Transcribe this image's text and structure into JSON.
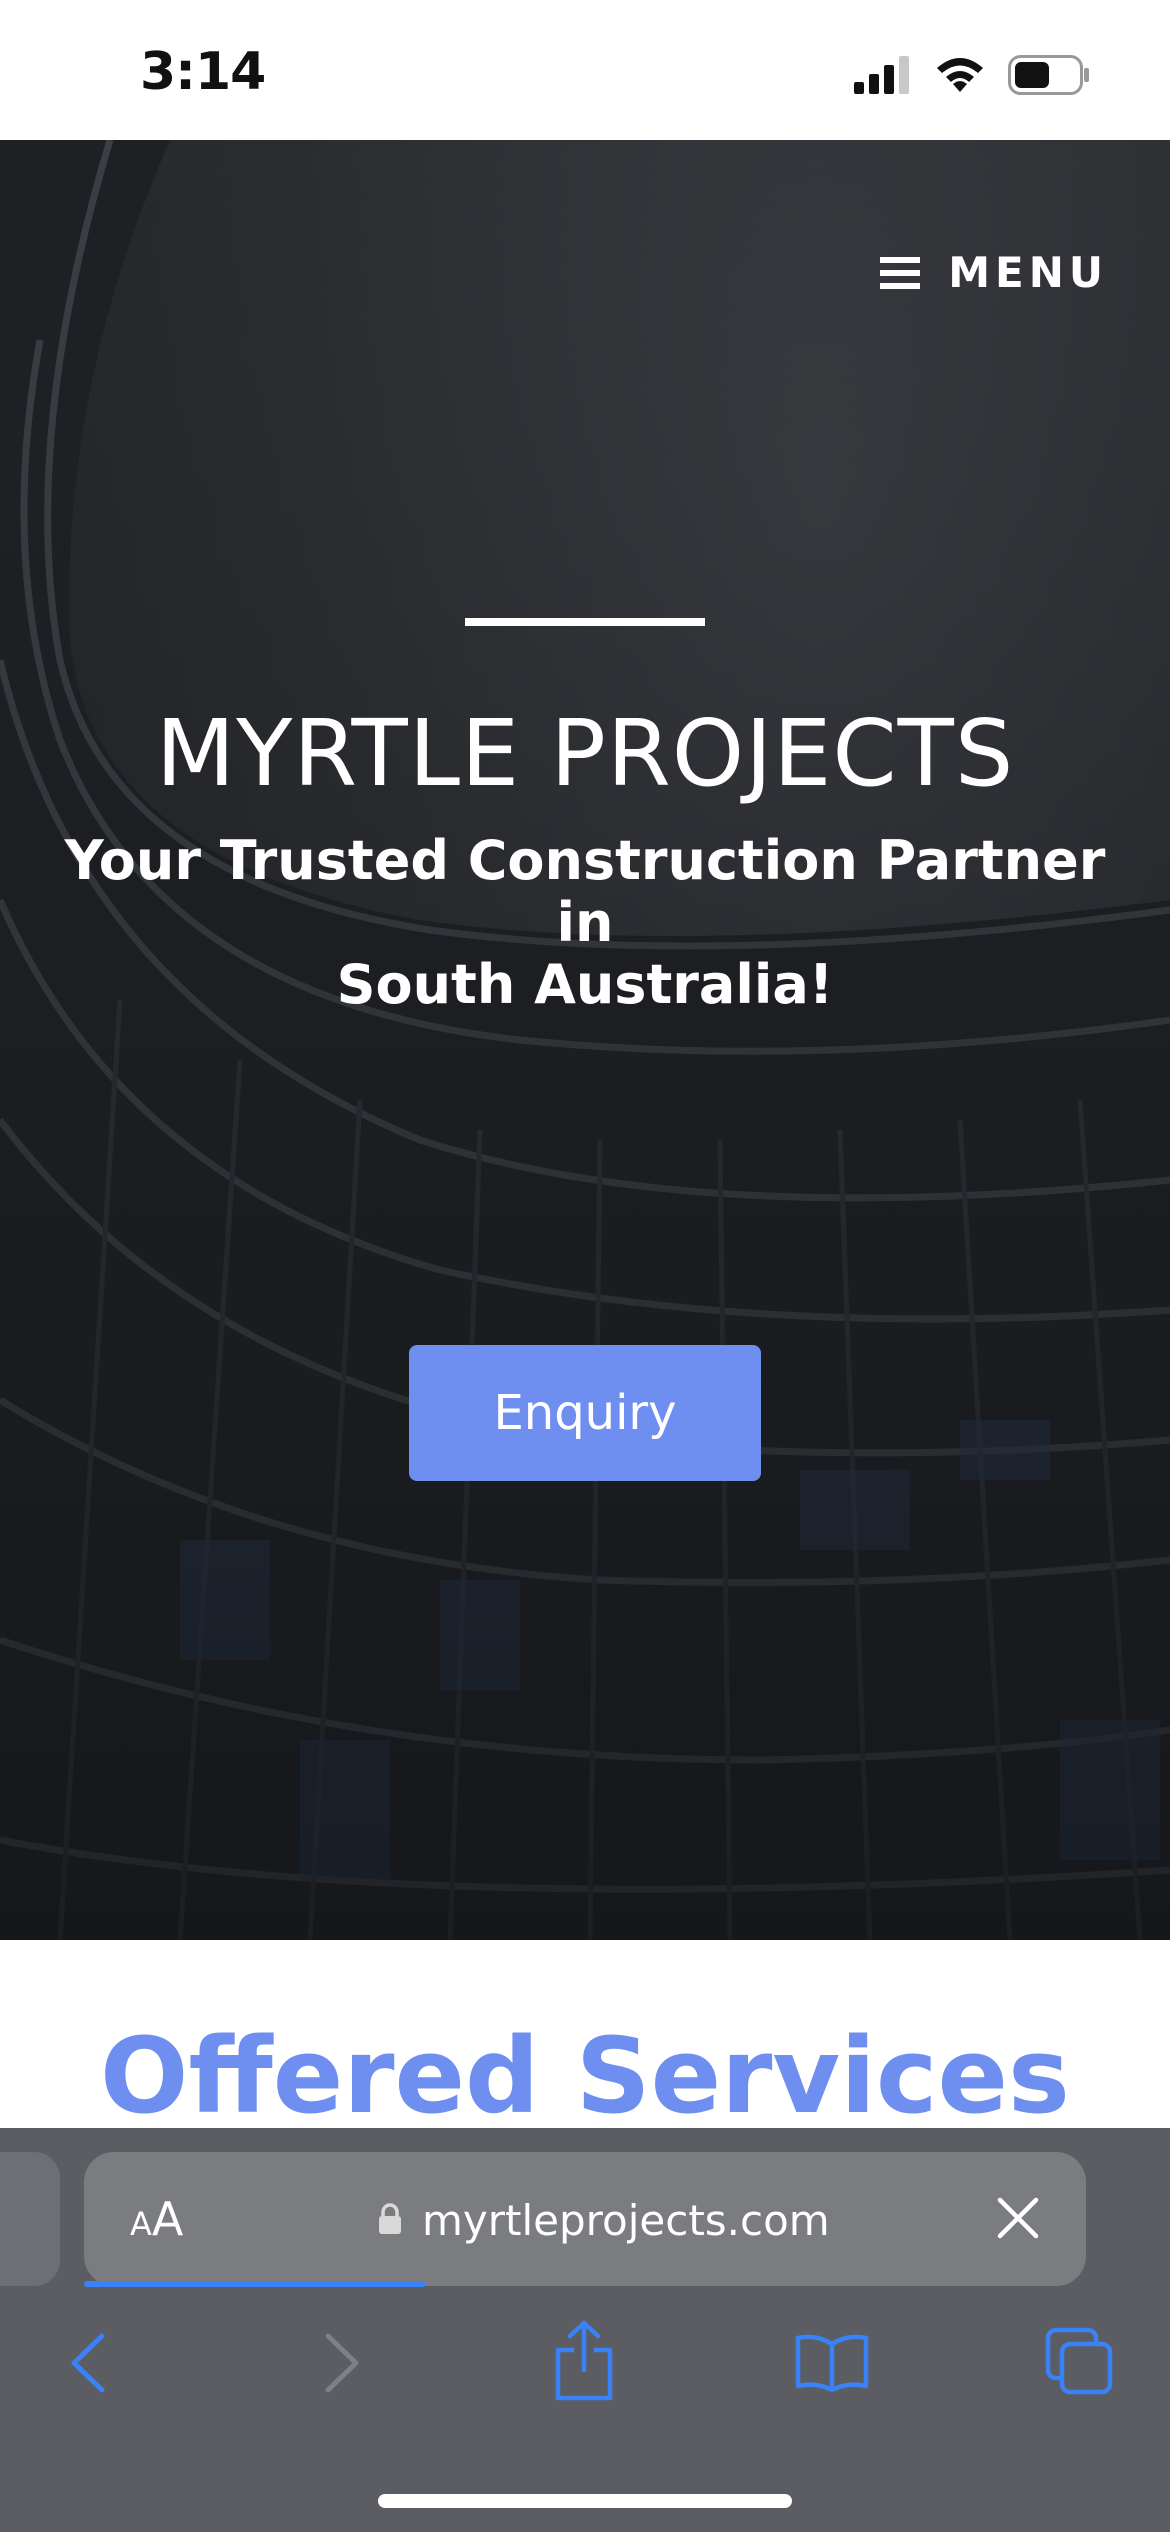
{
  "status_bar": {
    "time": "3:14"
  },
  "hero": {
    "menu_label": "MENU",
    "title": "MYRTLE PROJECTS",
    "subtitle_line1": "Your Trusted Construction Partner in",
    "subtitle_line2": "South Australia!",
    "cta_label": "Enquiry"
  },
  "services": {
    "title": "Offered Services"
  },
  "browser": {
    "text_size_label_small": "A",
    "text_size_label_large": "A",
    "url": "myrtleprojects.com",
    "toolbar_icons": [
      "back-icon",
      "forward-icon",
      "share-icon",
      "bookmarks-icon",
      "tabs-icon"
    ]
  },
  "colors": {
    "accent": "#6f8ff0",
    "hero_bg": "#2b2d31",
    "browser_bg": "#5b5d62",
    "safari_blue": "#3a82f7"
  }
}
